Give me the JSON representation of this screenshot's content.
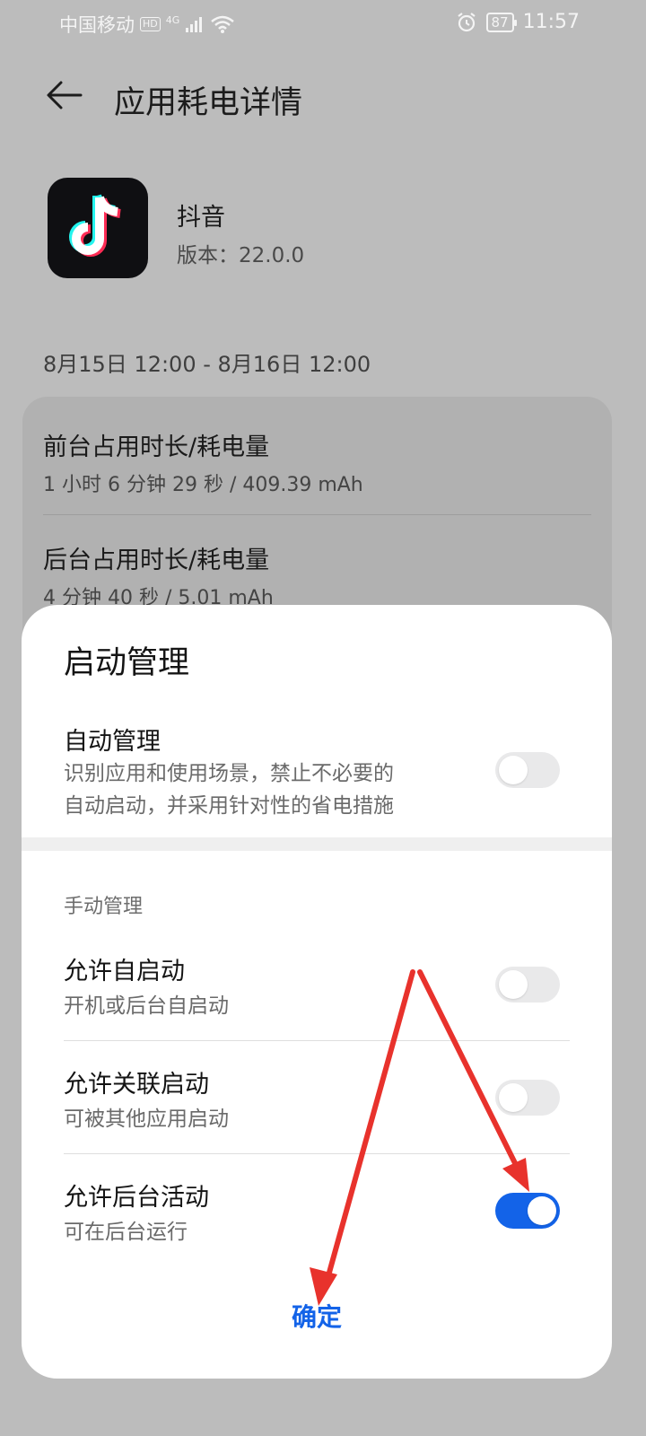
{
  "status_bar": {
    "carrier": "中国移动",
    "hd": "HD",
    "network": "4G",
    "battery": "87",
    "time": "11:57"
  },
  "header": {
    "title": "应用耗电详情"
  },
  "app": {
    "name": "抖音",
    "version": "版本：22.0.0"
  },
  "date_range": "8月15日 12:00 - 8月16日 12:00",
  "usage": {
    "foreground": {
      "title": "前台占用时长/耗电量",
      "value": "1 小时 6 分钟 29 秒 / 409.39 mAh"
    },
    "background": {
      "title": "后台占用时长/耗电量",
      "value": "4 分钟 40 秒 / 5.01 mAh"
    }
  },
  "sheet": {
    "title": "启动管理",
    "auto_manage": {
      "title": "自动管理",
      "desc_line1": "识别应用和使用场景，禁止不必要的",
      "desc_line2": "自动启动，并采用针对性的省电措施",
      "enabled": false
    },
    "manual_label": "手动管理",
    "items": [
      {
        "title": "允许自启动",
        "desc": "开机或后台自启动",
        "enabled": false
      },
      {
        "title": "允许关联启动",
        "desc": "可被其他应用启动",
        "enabled": false
      },
      {
        "title": "允许后台活动",
        "desc": "可在后台运行",
        "enabled": true
      }
    ],
    "confirm_label": "确定"
  },
  "colors": {
    "accent": "#1363e8",
    "annotation_arrow": "#e8322c"
  }
}
